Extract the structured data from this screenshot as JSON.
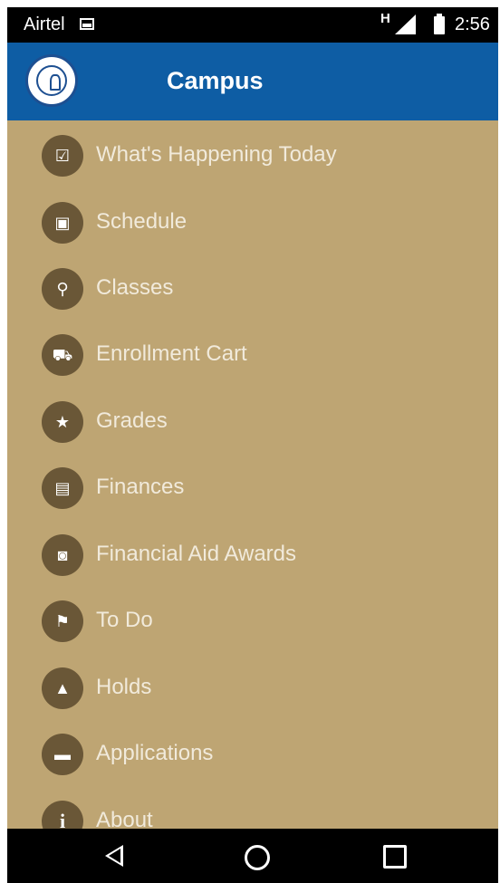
{
  "status_bar": {
    "carrier": "Airtel",
    "network_type": "H",
    "time": "2:56"
  },
  "app_bar": {
    "title": "Campus"
  },
  "menu": {
    "items": [
      {
        "label": "What's Happening Today",
        "icon": "calendar-check-icon",
        "glyph": "☑"
      },
      {
        "label": "Schedule",
        "icon": "calendar-icon",
        "glyph": "▣"
      },
      {
        "label": "Classes",
        "icon": "search-icon",
        "glyph": "⚲"
      },
      {
        "label": "Enrollment Cart",
        "icon": "cart-add-icon",
        "glyph": "⛟"
      },
      {
        "label": "Grades",
        "icon": "star-icon",
        "glyph": "★"
      },
      {
        "label": "Finances",
        "icon": "wallet-icon",
        "glyph": "▤"
      },
      {
        "label": "Financial Aid Awards",
        "icon": "camera-icon",
        "glyph": "◙"
      },
      {
        "label": "To Do",
        "icon": "flag-icon",
        "glyph": "⚑"
      },
      {
        "label": "Holds",
        "icon": "warning-icon",
        "glyph": "▲"
      },
      {
        "label": "Applications",
        "icon": "chat-icon",
        "glyph": "▬"
      },
      {
        "label": "About",
        "icon": "info-icon",
        "glyph": "i"
      }
    ]
  },
  "colors": {
    "app_bar": "#0e5da4",
    "menu_background": "#bea573",
    "icon_circle": "#6a5737",
    "label_text": "#f1eadb"
  }
}
